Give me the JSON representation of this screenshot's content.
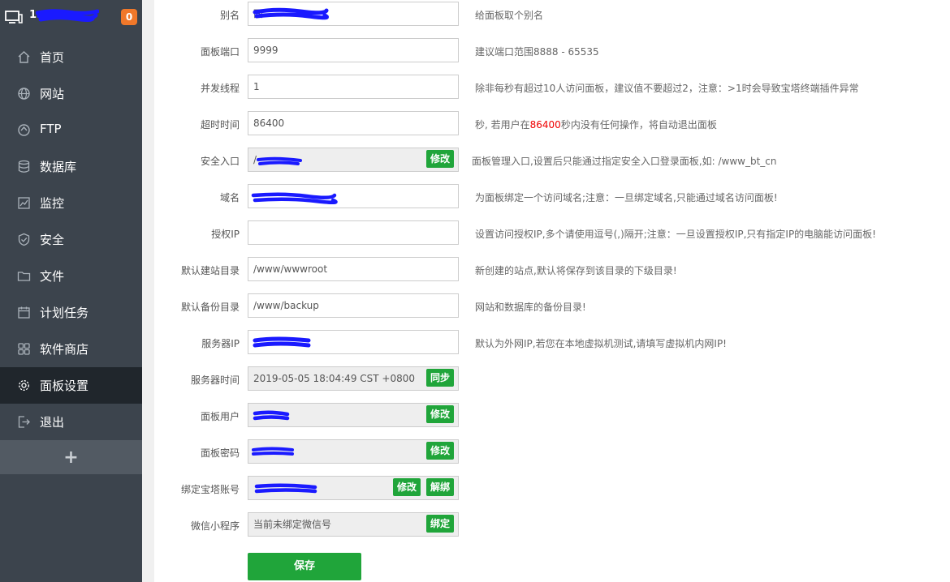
{
  "header": {
    "server_name": "1",
    "badge_count": "0"
  },
  "menu": [
    {
      "label": "首页",
      "icon": "home-icon"
    },
    {
      "label": "网站",
      "icon": "globe-icon"
    },
    {
      "label": "FTP",
      "icon": "ftp-icon"
    },
    {
      "label": "数据库",
      "icon": "database-icon"
    },
    {
      "label": "监控",
      "icon": "monitor-chart-icon"
    },
    {
      "label": "安全",
      "icon": "shield-icon"
    },
    {
      "label": "文件",
      "icon": "folder-icon"
    },
    {
      "label": "计划任务",
      "icon": "calendar-icon"
    },
    {
      "label": "软件商店",
      "icon": "apps-grid-icon"
    },
    {
      "label": "面板设置",
      "icon": "gear-icon",
      "active": true
    },
    {
      "label": "退出",
      "icon": "logout-icon"
    }
  ],
  "menu_add": "+",
  "form": {
    "alias": {
      "label": "别名",
      "value": "面",
      "hint": "给面板取个别名"
    },
    "port": {
      "label": "面板端口",
      "value": "9999",
      "hint": "建议端口范围8888 - 65535"
    },
    "threads": {
      "label": "并发线程",
      "value": "1",
      "hint": "除非每秒有超过10人访问面板，建议值不要超过2，注意：>1时会导致宝塔终端插件异常"
    },
    "timeout": {
      "label": "超时时间",
      "value": "86400",
      "hint_before": "秒, 若用户在",
      "hint_red": "86400",
      "hint_after": "秒内没有任何操作，将自动退出面板"
    },
    "entry": {
      "label": "安全入口",
      "value": "/",
      "button": "修改",
      "hint": "面板管理入口,设置后只能通过指定安全入口登录面板,如: /www_bt_cn"
    },
    "domain": {
      "label": "域名",
      "value": "",
      "hint": "为面板绑定一个访问域名;注意：一旦绑定域名,只能通过域名访问面板!"
    },
    "auth_ip": {
      "label": "授权IP",
      "value": "",
      "hint": "设置访问授权IP,多个请使用逗号(,)隔开;注意：一旦设置授权IP,只有指定IP的电脑能访问面板!"
    },
    "site_dir": {
      "label": "默认建站目录",
      "value": "/www/wwwroot",
      "hint": "新创建的站点,默认将保存到该目录的下级目录!"
    },
    "backup_dir": {
      "label": "默认备份目录",
      "value": "/www/backup",
      "hint": "网站和数据库的备份目录!"
    },
    "server_ip": {
      "label": "服务器IP",
      "value": "",
      "hint": "默认为外网IP,若您在本地虚拟机测试,请填写虚拟机内网IP!"
    },
    "server_time": {
      "label": "服务器时间",
      "value": "2019-05-05 18:04:49 CST +0800",
      "button": "同步"
    },
    "panel_user": {
      "label": "面板用户",
      "value": "",
      "button": "修改"
    },
    "panel_pass": {
      "label": "面板密码",
      "value": "",
      "button": "修改"
    },
    "bt_account": {
      "label": "绑定宝塔账号",
      "value": "",
      "button": "修改",
      "button2": "解绑"
    },
    "wechat": {
      "label": "微信小程序",
      "value": "当前未绑定微信号",
      "button": "绑定"
    }
  },
  "save_label": "保存",
  "colors": {
    "sidebar": "#3c444d",
    "active": "#20262c",
    "green": "#20a53a",
    "badge": "#f0782a",
    "redaction": "#0000ff"
  }
}
